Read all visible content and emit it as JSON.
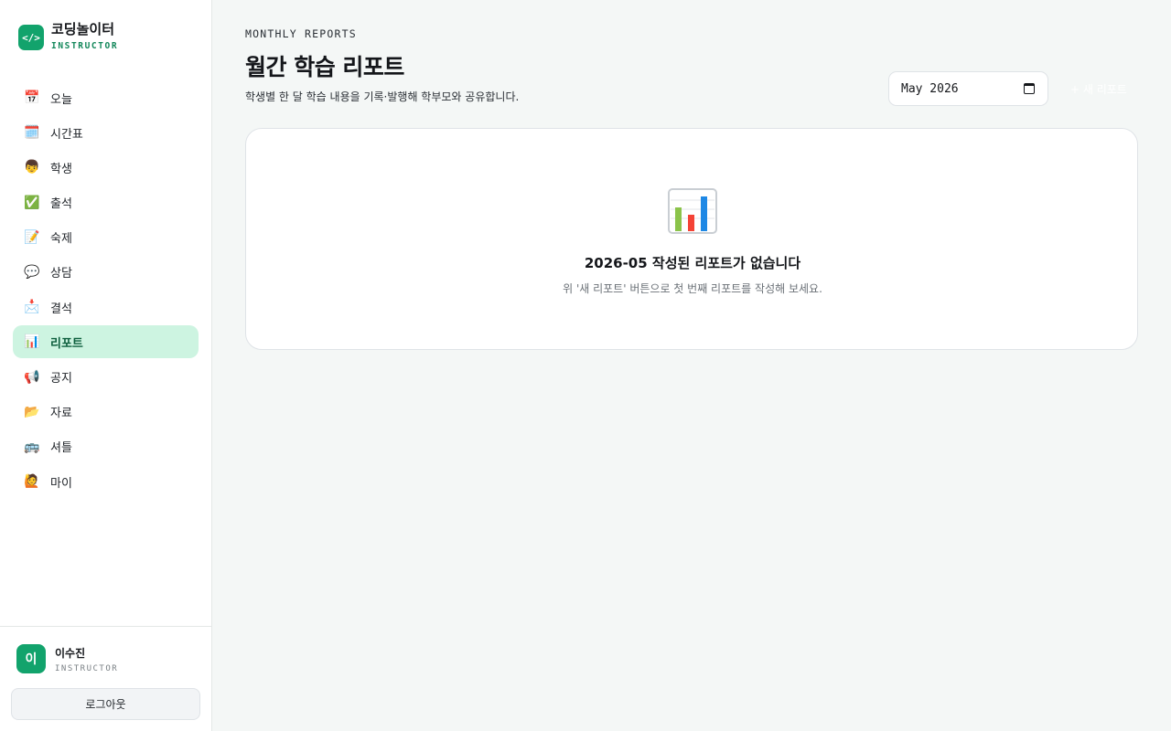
{
  "brand": {
    "name": "코딩놀이터",
    "role": "INSTRUCTOR",
    "logo_glyph": "</>",
    "color": "#12a36c"
  },
  "nav": {
    "items": [
      {
        "label": "오늘",
        "icon": "calendar-icon",
        "glyph": "📅"
      },
      {
        "label": "시간표",
        "icon": "spiral-calendar-icon",
        "glyph": "🗓️"
      },
      {
        "label": "학생",
        "icon": "boy-icon",
        "glyph": "👦"
      },
      {
        "label": "출석",
        "icon": "check-mark-icon",
        "glyph": "✅"
      },
      {
        "label": "숙제",
        "icon": "memo-icon",
        "glyph": "📝"
      },
      {
        "label": "상담",
        "icon": "speech-bubble-icon",
        "glyph": "💬"
      },
      {
        "label": "결석",
        "icon": "envelope-arrow-icon",
        "glyph": "📩"
      },
      {
        "label": "리포트",
        "icon": "bar-chart-icon",
        "glyph": "📊",
        "active": true
      },
      {
        "label": "공지",
        "icon": "megaphone-icon",
        "glyph": "📢"
      },
      {
        "label": "자료",
        "icon": "folder-icon",
        "glyph": "📂"
      },
      {
        "label": "셔틀",
        "icon": "bus-icon",
        "glyph": "🚌"
      },
      {
        "label": "마이",
        "icon": "person-raising-hand-icon",
        "glyph": "🙋"
      }
    ],
    "active_color": "#cdf4e1"
  },
  "user": {
    "initial": "이",
    "name": "이수진",
    "role": "INSTRUCTOR"
  },
  "logout_label": "로그아웃",
  "header": {
    "eyebrow": "MONTHLY REPORTS",
    "title": "월간 학습 리포트",
    "subtitle": "학생별 한 달 학습 내용을 기록·발행해 학부모와 공유합니다.",
    "month_value": "May 2026",
    "new_report_label": "+ 새 리포트"
  },
  "empty_state": {
    "icon": "bar-chart-icon",
    "title": "2026-05 작성된 리포트가 없습니다",
    "subtitle": "위 '새 리포트' 버튼으로 첫 번째 리포트를 작성해 보세요."
  }
}
